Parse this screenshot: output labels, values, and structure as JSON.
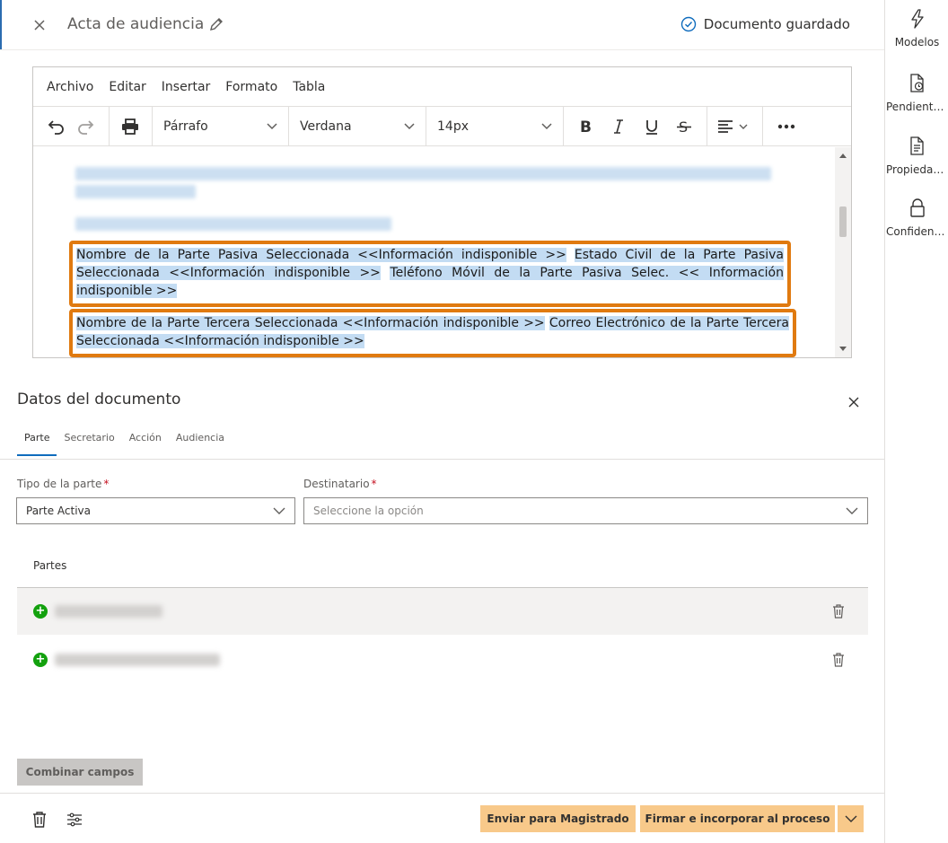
{
  "header": {
    "title": "Acta de audiencia",
    "saved_status": "Documento guardado"
  },
  "editor": {
    "menu": [
      "Archivo",
      "Editar",
      "Insertar",
      "Formato",
      "Tabla"
    ],
    "toolbar": {
      "paragraph": "Párrafo",
      "font": "Verdana",
      "size": "14px"
    },
    "content": {
      "block1": [
        "Nombre de la Parte Pasiva Seleccionada <<Información indisponible >>",
        "Estado Civil de la Parte Pasiva Seleccionada <<Información indisponible >>",
        "Teléfono Móvil de la Parte Pasiva Selec. << Información indisponible >>"
      ],
      "block2": [
        "Nombre de la Parte Tercera Seleccionada <<Información indisponible >>",
        "Correo Electrónico de la Parte Tercera Seleccionada <<Información indisponible >>"
      ]
    },
    "highlight_color": "#e07a10"
  },
  "panel": {
    "title": "Datos del documento",
    "tabs": [
      "Parte",
      "Secretario",
      "Acción",
      "Audiencia"
    ],
    "active_tab": "Parte",
    "tipo_label": "Tipo de la parte",
    "tipo_value": "Parte Activa",
    "destinatario_label": "Destinatario",
    "destinatario_placeholder": "Seleccione la opción",
    "required_mark": "*",
    "partes_label": "Partes",
    "combine_button": "Combinar campos"
  },
  "footer": {
    "send_button": "Enviar para Magistrado",
    "sign_button": "Firmar e incorporar al proceso",
    "button_color": "#f8c98a"
  },
  "rail": {
    "items": [
      {
        "label": "Modelos",
        "icon": "lightning-icon"
      },
      {
        "label": "Pendiente…",
        "icon": "pending-document-icon"
      },
      {
        "label": "Propieda…",
        "icon": "properties-document-icon"
      },
      {
        "label": "Confidenc…",
        "icon": "lock-icon"
      }
    ]
  }
}
